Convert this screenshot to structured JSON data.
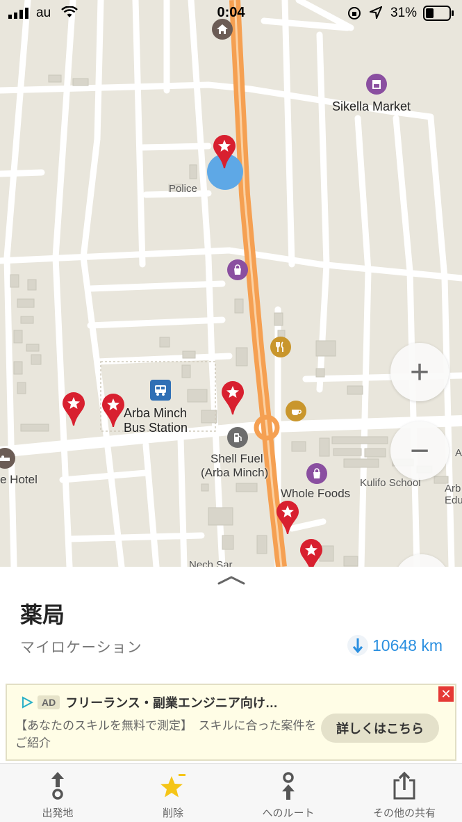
{
  "status_bar": {
    "carrier": "au",
    "time": "0:04",
    "battery_percent": "31%"
  },
  "map": {
    "labels": {
      "sikella_market": "Sikella Market",
      "police": "Police",
      "bus_station_line1": "Arba Minch",
      "bus_station_line2": "Bus Station",
      "shell_line1": "Shell Fuel",
      "shell_line2": "(Arba Minch)",
      "hotel": "e Hotel",
      "whole_foods": "Whole Foods",
      "kulifo_school": "Kulifo School",
      "arba_edu_line1": "Arb",
      "arba_edu_line2": "Edu",
      "right_edge_a": "A",
      "bottom_partial": "Nech Sar"
    },
    "zoom_in_label": "+",
    "zoom_out_label": "−"
  },
  "sheet": {
    "title": "薬局",
    "subtitle": "マイロケーション",
    "distance": "10648 km"
  },
  "ad": {
    "badge": "AD",
    "title": "フリーランス・副業エンジニア向け…",
    "body": "【あなたのスキルを無料で測定】　スキルに合った案件をご紹介",
    "cta": "詳しくはこちら",
    "close": "✕"
  },
  "tabbar": {
    "items": [
      {
        "label": "出発地",
        "icon": "start-point-icon"
      },
      {
        "label": "削除",
        "icon": "star-remove-icon"
      },
      {
        "label": "へのルート",
        "icon": "route-to-icon"
      },
      {
        "label": "その他の共有",
        "icon": "share-icon"
      }
    ]
  },
  "colors": {
    "main_road": "#f5a052",
    "pin": "#d8202f",
    "location_dot": "#5ea8e6",
    "accent_blue": "#2a8fe0"
  }
}
